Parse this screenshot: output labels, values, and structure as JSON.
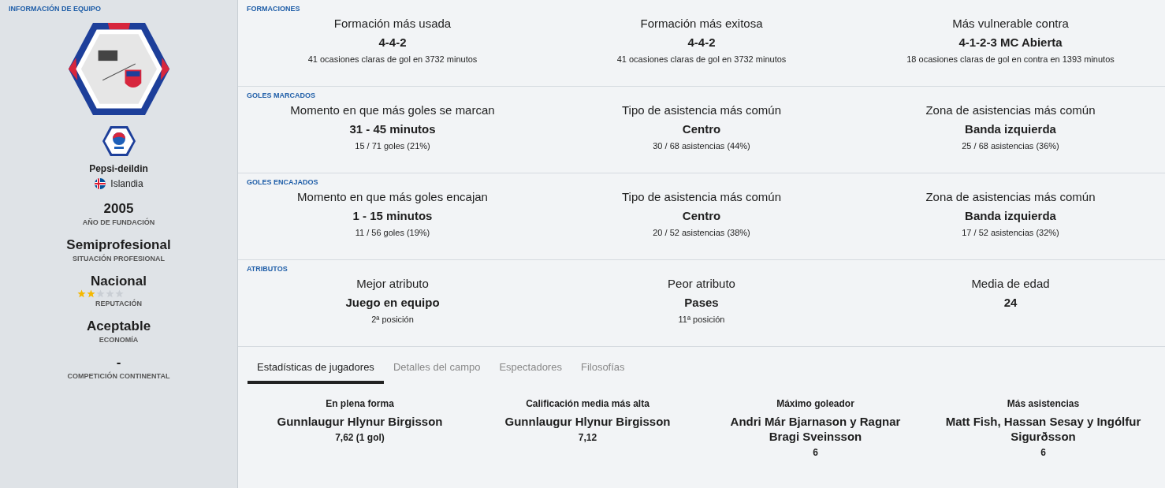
{
  "sidebar": {
    "heading": "INFORMACIÓN DE EQUIPO",
    "league": "Pepsi-deildin",
    "nation": "Islandia",
    "facts": [
      {
        "value": "2005",
        "label": "AÑO DE FUNDACIÓN"
      },
      {
        "value": "Semiprofesional",
        "label": "SITUACIÓN PROFESIONAL"
      },
      {
        "value": "Nacional",
        "label": "REPUTACIÓN",
        "stars": 2
      },
      {
        "value": "Aceptable",
        "label": "ECONOMÍA"
      },
      {
        "value": "-",
        "label": "COMPETICIÓN CONTINENTAL"
      }
    ]
  },
  "sections": [
    {
      "heading": "FORMACIONES",
      "items": [
        {
          "title": "Formación más usada",
          "value": "4-4-2",
          "detail": "41 ocasiones claras de gol en 3732 minutos"
        },
        {
          "title": "Formación más exitosa",
          "value": "4-4-2",
          "detail": "41 ocasiones claras de gol en 3732 minutos"
        },
        {
          "title": "Más vulnerable contra",
          "value": "4-1-2-3 MC Abierta",
          "detail": "18 ocasiones claras de gol en contra en 1393 minutos"
        }
      ]
    },
    {
      "heading": "GOLES MARCADOS",
      "items": [
        {
          "title": "Momento en que más goles se marcan",
          "value": "31 - 45 minutos",
          "detail": "15 / 71 goles (21%)"
        },
        {
          "title": "Tipo de asistencia más común",
          "value": "Centro",
          "detail": "30 / 68 asistencias (44%)"
        },
        {
          "title": "Zona de asistencias más común",
          "value": "Banda izquierda",
          "detail": "25 / 68 asistencias (36%)"
        }
      ]
    },
    {
      "heading": "GOLES ENCAJADOS",
      "items": [
        {
          "title": "Momento en que más goles encajan",
          "value": "1 - 15 minutos",
          "detail": "11 / 56 goles (19%)"
        },
        {
          "title": "Tipo de asistencia más común",
          "value": "Centro",
          "detail": "20 / 52 asistencias (38%)"
        },
        {
          "title": "Zona de asistencias más común",
          "value": "Banda izquierda",
          "detail": "17 / 52 asistencias (32%)"
        }
      ]
    },
    {
      "heading": "ATRIBUTOS",
      "items": [
        {
          "title": "Mejor atributo",
          "value": "Juego en equipo",
          "detail": "2ª posición"
        },
        {
          "title": "Peor atributo",
          "value": "Pases",
          "detail": "11ª posición"
        },
        {
          "title": "Media de edad",
          "value": "24"
        }
      ]
    }
  ],
  "tabs": [
    {
      "label": "Estadísticas de jugadores",
      "selected": true
    },
    {
      "label": "Detalles del campo",
      "selected": false
    },
    {
      "label": "Espectadores",
      "selected": false
    },
    {
      "label": "Filosofías",
      "selected": false
    }
  ],
  "player_stats": [
    {
      "title": "En plena forma",
      "player": "Gunnlaugur Hlynur Birgisson",
      "value": "7,62 (1 gol)"
    },
    {
      "title": "Calificación media más alta",
      "player": "Gunnlaugur Hlynur Birgisson",
      "value": "7,12"
    },
    {
      "title": "Máximo goleador",
      "player": "Andri Már Bjarnason y Ragnar Bragi Sveinsson",
      "value": "6"
    },
    {
      "title": "Más asistencias",
      "player": "Matt Fish, Hassan Sesay y Ingólfur Sigurðsson",
      "value": "6"
    }
  ]
}
